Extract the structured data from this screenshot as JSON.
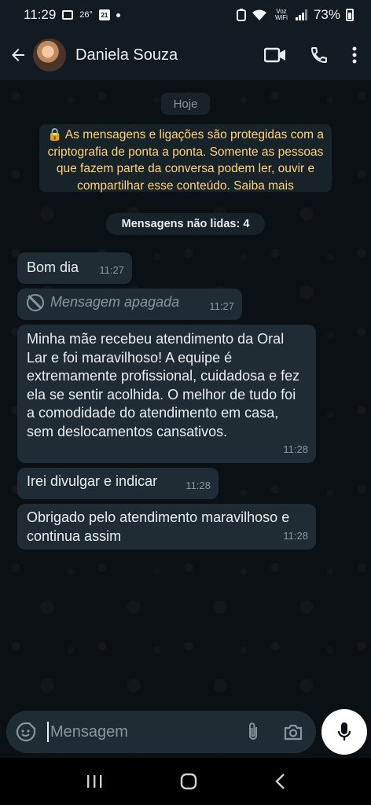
{
  "status_bar": {
    "time": "11:29",
    "temperature": "26°",
    "calendar_day": "21",
    "network_label": "Voz WiFi",
    "battery": "73%"
  },
  "header": {
    "contact_name": "Daniela Souza",
    "icons": [
      "back-arrow-icon",
      "video-call-icon",
      "phone-call-icon",
      "more-options-icon"
    ]
  },
  "chat": {
    "date_label": "Hoje",
    "encryption_notice": "🔒 As mensagens e ligações são protegidas com a criptografia de ponta a ponta. Somente as pessoas que fazem parte da conversa podem ler, ouvir e compartilhar esse conteúdo. Saiba mais",
    "unread_label": "Mensagens não lidas: 4",
    "messages": [
      {
        "text": "Bom dia",
        "time": "11:27"
      },
      {
        "text": "Mensagem apagada",
        "time": "11:27",
        "deleted": true
      },
      {
        "text": "Minha mãe recebeu atendimento da Oral Lar e foi maravilhoso! A equipe é extremamente profissional, cuidadosa e fez ela se sentir acolhida. O melhor de tudo foi a comodidade do atendimento em casa, sem deslocamentos cansativos.",
        "time": "11:28"
      },
      {
        "text": "Irei divulgar e indicar",
        "time": "11:28"
      },
      {
        "text": "Obrigado pelo atendimento maravilhoso e continua assim",
        "time": "11:28"
      }
    ]
  },
  "composer": {
    "placeholder": "Mensagem",
    "icons": [
      "sticker-icon",
      "attach-icon",
      "camera-icon",
      "mic-icon"
    ]
  },
  "colors": {
    "background": "#0b1014",
    "bubble": "#202c33",
    "header": "#111b21",
    "notice_text": "#ffd279",
    "muted": "#8696a0"
  }
}
